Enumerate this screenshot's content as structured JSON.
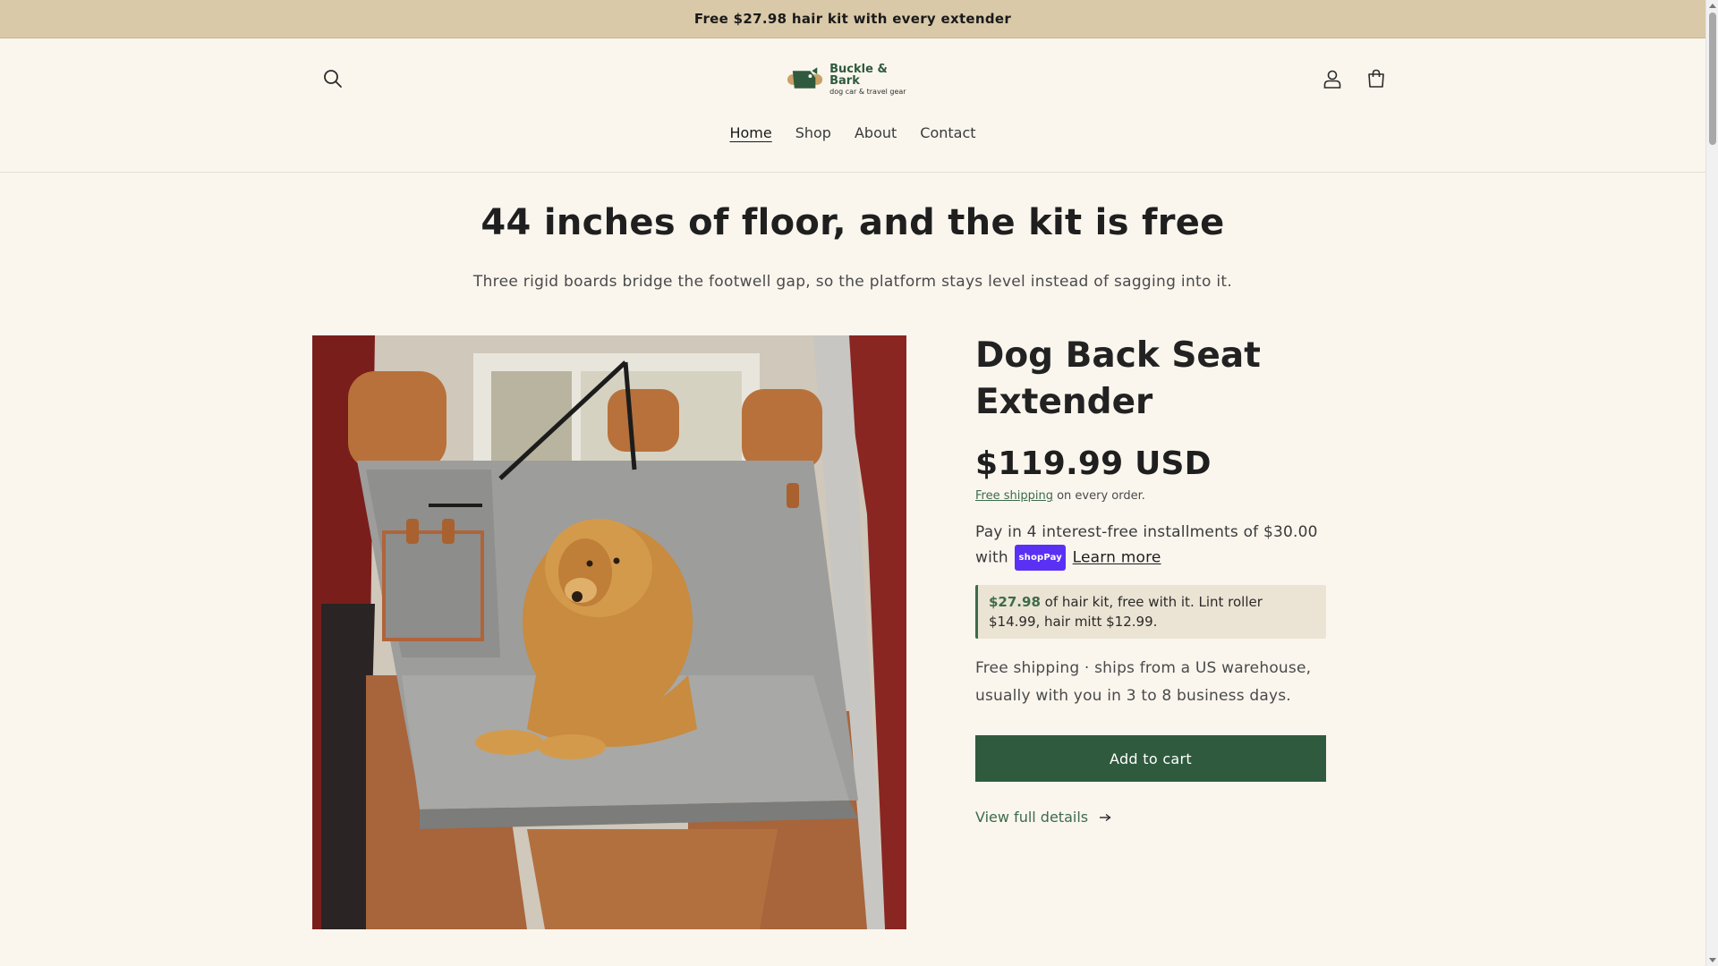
{
  "announcement": {
    "text": "Free $27.98 hair kit with every extender"
  },
  "header": {
    "logo": {
      "name": "Buckle & Bark",
      "tagline": "dog car & travel gear"
    },
    "nav": [
      {
        "label": "Home",
        "active": true
      },
      {
        "label": "Shop",
        "active": false
      },
      {
        "label": "About",
        "active": false
      },
      {
        "label": "Contact",
        "active": false
      }
    ],
    "icons": [
      "search-icon",
      "account-icon",
      "cart-icon"
    ]
  },
  "hero": {
    "headline": "44 inches of floor, and the kit is free",
    "subhead": "Three rigid boards bridge the footwell gap, so the platform stays level instead of sagging into it."
  },
  "product": {
    "image_alt": "Golden retriever lying on a gray quilted back seat extender inside a car with tan leather seats",
    "title": "Dog Back Seat Extender",
    "price": "$119.99 USD",
    "shipping_link": "Free shipping",
    "shipping_suffix": " on every order.",
    "installments_prefix": "Pay in 4 interest-free installments of $30.00 with",
    "shoppay_badge": "shopPay",
    "learn_more": "Learn more",
    "kit_highlight": "$27.98",
    "kit_text": " of hair kit, free with it. Lint roller $14.99, hair mitt $12.99.",
    "ship_note": "Free shipping · ships from a US warehouse, usually with you in 3 to 8 business days.",
    "add_to_cart": "Add to cart",
    "view_details": "View full details",
    "view_details_icon": "arrow-right-icon"
  },
  "colors": {
    "background": "#faf6ee",
    "announcement_bg": "#d9c9a8",
    "accent_green": "#2f5a3e",
    "kit_box_bg": "#ebe4d4"
  }
}
